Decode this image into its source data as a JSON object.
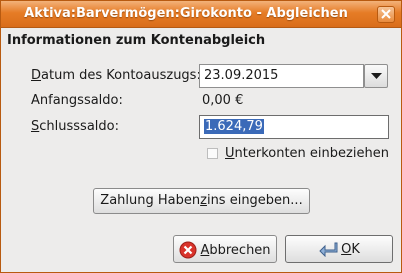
{
  "window": {
    "title": "Aktiva:Barvermögen:Girokonto - Abgleichen"
  },
  "section": {
    "heading": "Informationen zum Kontenabgleich"
  },
  "form": {
    "date": {
      "label_u": "D",
      "label_rest": "atum des Kontoauszugs:",
      "value": "23.09.2015"
    },
    "start": {
      "label": "Anfangssaldo:",
      "value": "0,00 €"
    },
    "end": {
      "label_u": "S",
      "label_rest": "chlusssaldo:",
      "value": "1.624,79"
    },
    "subaccounts": {
      "label_u": "U",
      "label_rest": "nterkonten einbeziehen",
      "checked": false
    }
  },
  "buttons": {
    "interest": {
      "pre": "Zahlung Haben",
      "u": "z",
      "post": "ins eingeben..."
    },
    "cancel": {
      "u": "A",
      "rest": "bbrechen"
    },
    "ok": {
      "u": "O",
      "rest": "K"
    }
  },
  "icons": {
    "close": "close-icon",
    "dropdown": "chevron-down-icon",
    "cancel": "cancel-icon",
    "ok": "ok-arrow-icon"
  },
  "colors": {
    "titlebar": "#e67c26",
    "selection": "#3b6ab8",
    "cancel_icon": "#d9332b"
  }
}
